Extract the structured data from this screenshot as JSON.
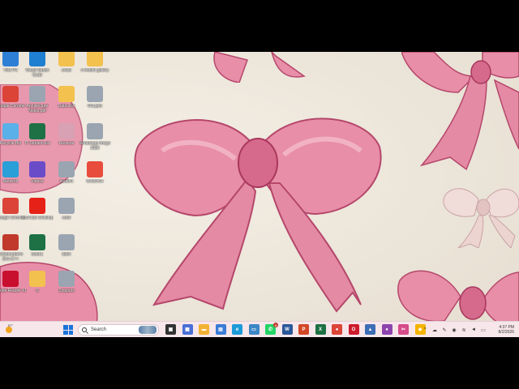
{
  "desktop": {
    "icons": [
      {
        "label": "This PC",
        "icon": "computer-icon",
        "color": "#2d7fd6"
      },
      {
        "label": "Visual Studio Code",
        "icon": "vscode-icon",
        "color": "#1f7fd0"
      },
      {
        "label": "cms2",
        "icon": "folder-icon",
        "color": "#f2c14e"
      },
      {
        "label": "e-health gallery",
        "icon": "folder-icon",
        "color": "#f2c14e"
      },
      {
        "label": "Google Chrome",
        "icon": "chrome-icon",
        "color": "#db4437"
      },
      {
        "label": "Architecture Notes.pdf",
        "icon": "document-icon",
        "color": "#9aa5b1"
      },
      {
        "label": "Data.xlsx",
        "icon": "folder-icon",
        "color": "#f2c14e"
      },
      {
        "label": "OS.pptx",
        "icon": "document-icon",
        "color": "#9aa5b1"
      },
      {
        "label": "Recycle Bin",
        "icon": "recycle-bin-icon",
        "color": "#5ab0e8"
      },
      {
        "label": "IT Student list",
        "icon": "excel-icon",
        "color": "#1e7145"
      },
      {
        "label": "Resume",
        "icon": "document-icon",
        "color": "#d8a1b4"
      },
      {
        "label": "WhatsApp Image 2026",
        "icon": "image-file-icon",
        "color": "#9aa5b1"
      },
      {
        "label": "Network",
        "icon": "network-icon",
        "color": "#2a9fd8"
      },
      {
        "label": "Videos",
        "icon": "video-icon",
        "color": "#6a4cc9"
      },
      {
        "label": "student",
        "icon": "document-icon",
        "color": "#9aa5b1"
      },
      {
        "label": "OneDrive",
        "icon": "app-icon",
        "color": "#e74c3c"
      },
      {
        "label": "Google Chrome",
        "icon": "chrome-icon",
        "color": "#db4437"
      },
      {
        "label": "YouTube Desktop",
        "icon": "youtube-icon",
        "color": "#e62117"
      },
      {
        "label": "code",
        "icon": "document-icon",
        "color": "#9aa5b1"
      },
      {
        "label": "Embarcadero Dev-C++",
        "icon": "devcpp-icon",
        "color": "#c0392b"
      },
      {
        "label": "Book1",
        "icon": "excel-icon",
        "color": "#1e7145"
      },
      {
        "label": "table",
        "icon": "document-icon",
        "color": "#9aa5b1"
      },
      {
        "label": "Adobe Reader XI",
        "icon": "acrobat-icon",
        "color": "#c8102e"
      },
      {
        "label": "S",
        "icon": "folder-icon",
        "color": "#f2c14e"
      },
      {
        "label": "Snippets",
        "icon": "document-icon",
        "color": "#9aa5b1"
      }
    ]
  },
  "taskbar": {
    "weather_temp": "87°",
    "search_placeholder": "Search",
    "apps": [
      {
        "name": "task-view",
        "icon": "task-view-icon",
        "color": "#333333",
        "glyph": "▣"
      },
      {
        "name": "widgets",
        "icon": "widgets-icon",
        "color": "#4a6fd6",
        "glyph": "▦"
      },
      {
        "name": "file-explorer",
        "icon": "folder-icon",
        "color": "#f2b233",
        "glyph": "▬"
      },
      {
        "name": "store",
        "icon": "store-icon",
        "color": "#3a7bd5",
        "glyph": "▤"
      },
      {
        "name": "edge",
        "icon": "edge-icon",
        "color": "#1c9bd8",
        "glyph": "e"
      },
      {
        "name": "files",
        "icon": "files-icon",
        "color": "#3d86c6",
        "glyph": "▭"
      },
      {
        "name": "whatsapp",
        "icon": "whatsapp-icon",
        "color": "#25d366",
        "glyph": "✆",
        "badge": "2"
      },
      {
        "name": "word",
        "icon": "word-icon",
        "color": "#2b579a",
        "glyph": "W"
      },
      {
        "name": "powerpoint",
        "icon": "powerpoint-icon",
        "color": "#d24726",
        "glyph": "P"
      },
      {
        "name": "excel",
        "icon": "excel-icon",
        "color": "#1e7145",
        "glyph": "X"
      },
      {
        "name": "chrome",
        "icon": "chrome-icon",
        "color": "#db4437",
        "glyph": "●"
      },
      {
        "name": "opera",
        "icon": "opera-icon",
        "color": "#cc1b2b",
        "glyph": "O"
      },
      {
        "name": "photos",
        "icon": "photos-icon",
        "color": "#3d6db5",
        "glyph": "▲"
      },
      {
        "name": "chrome-profile",
        "icon": "chrome-icon",
        "color": "#8e44ad",
        "glyph": "●"
      },
      {
        "name": "snipping-tool",
        "icon": "snipping-tool-icon",
        "color": "#d64c8a",
        "glyph": "✂"
      },
      {
        "name": "google-drive",
        "icon": "drive-icon",
        "color": "#f4b400",
        "glyph": "◆"
      }
    ],
    "tray": {
      "chevron": "^",
      "time": "4:37 PM",
      "date": "8/2/2026"
    }
  }
}
